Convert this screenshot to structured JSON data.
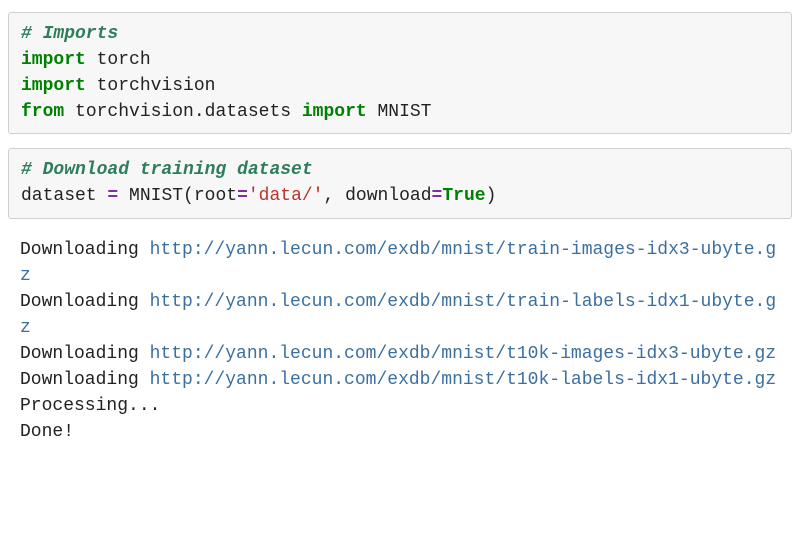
{
  "cells": [
    {
      "comment": "# Imports",
      "lines": [
        {
          "kw1": "import",
          "name": " torch"
        },
        {
          "kw1": "import",
          "name": " torchvision"
        },
        {
          "kw1": "from",
          "mod": " torchvision.datasets ",
          "kw2": "import",
          "name": " MNIST"
        }
      ]
    },
    {
      "comment": "# Download training dataset",
      "assign_lhs": "dataset ",
      "assign_op": "=",
      "assign_rhs1": " MNIST(root",
      "assign_eq1": "=",
      "assign_str": "'data/'",
      "assign_rhs2": ", download",
      "assign_eq2": "=",
      "assign_bool": "True",
      "assign_rhs3": ")"
    }
  ],
  "output": [
    {
      "prefix": "Downloading ",
      "url": "http://yann.lecun.com/exdb/mnist/train-images-idx3-ubyte.gz"
    },
    {
      "prefix": "Downloading ",
      "url": "http://yann.lecun.com/exdb/mnist/train-labels-idx1-ubyte.gz"
    },
    {
      "prefix": "Downloading ",
      "url": "http://yann.lecun.com/exdb/mnist/t10k-images-idx3-ubyte.gz"
    },
    {
      "prefix": "Downloading ",
      "url": "http://yann.lecun.com/exdb/mnist/t10k-labels-idx1-ubyte.gz"
    },
    {
      "text": "Processing..."
    },
    {
      "text": "Done!"
    }
  ]
}
